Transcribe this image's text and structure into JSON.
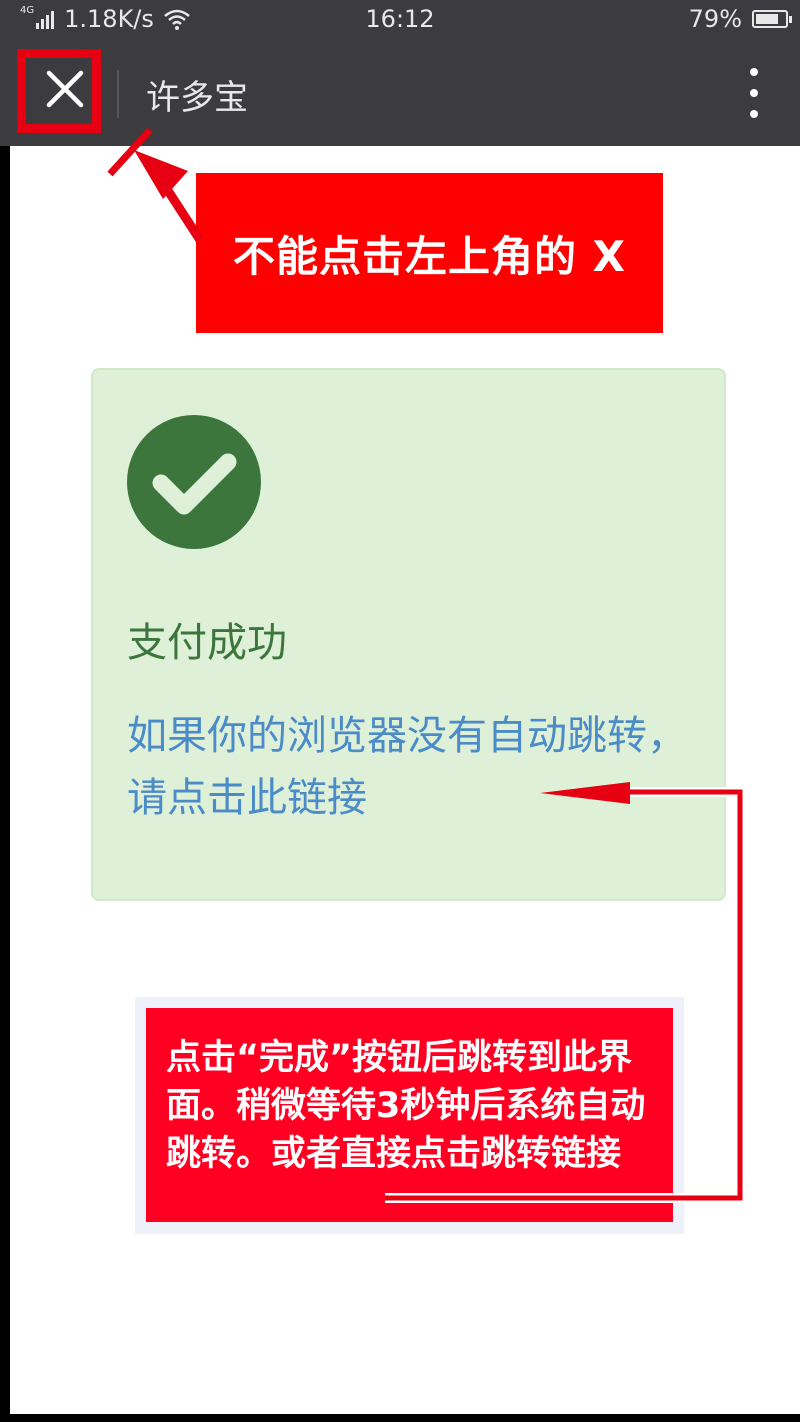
{
  "status_bar": {
    "network": "4G",
    "speed": "1.18K/s",
    "time": "16:12",
    "battery": "79%",
    "battery_level": 0.79
  },
  "nav": {
    "close_glyph": "✕",
    "title": "许多宝"
  },
  "annotations": {
    "top_callout": "不能点击左上角的 X",
    "bottom_callout": "点击“完成”按钮后跳转到此界面。稍微等待3秒钟后系统自动跳转。或者直接点击跳转链接"
  },
  "card": {
    "title": "支付成功",
    "redirect_text": "如果你的浏览器没有自动跳转，请点击此链接"
  },
  "colors": {
    "nav_background": "#3b3b40",
    "annotation_red": "#ff0000",
    "success_background": "#dff0d8",
    "success_green": "#3c763d",
    "link_blue": "#4a8bc8"
  },
  "icons": {
    "close": "close-icon",
    "menu": "more-vertical-icon",
    "success": "check-circle-icon",
    "wifi": "wifi-icon",
    "signal": "signal-icon",
    "battery": "battery-icon"
  }
}
